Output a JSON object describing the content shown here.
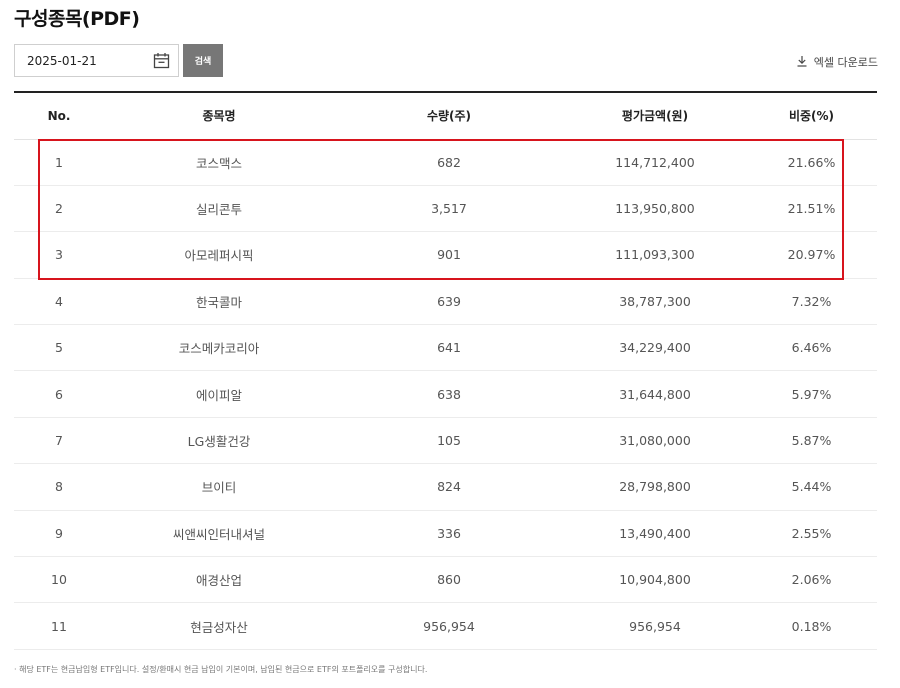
{
  "page": {
    "title": "구성종목(PDF)",
    "date_value": "2025-01-21",
    "search_label": "검색",
    "download_label": "엑셀 다운로드",
    "note": "· 해당 ETF는 현금납입형 ETF입니다. 설정/환매시 현금 납입이 기본이며, 납입된 현금으로 ETF의 포트폴리오를 구성합니다."
  },
  "table": {
    "headers": [
      "No.",
      "종목명",
      "수량(주)",
      "평가금액(원)",
      "비중(%)"
    ],
    "rows": [
      [
        "1",
        "코스맥스",
        "682",
        "114,712,400",
        "21.66%"
      ],
      [
        "2",
        "실리콘투",
        "3,517",
        "113,950,800",
        "21.51%"
      ],
      [
        "3",
        "아모레퍼시픽",
        "901",
        "111,093,300",
        "20.97%"
      ],
      [
        "4",
        "한국콜마",
        "639",
        "38,787,300",
        "7.32%"
      ],
      [
        "5",
        "코스메카코리아",
        "641",
        "34,229,400",
        "6.46%"
      ],
      [
        "6",
        "에이피알",
        "638",
        "31,644,800",
        "5.97%"
      ],
      [
        "7",
        "LG생활건강",
        "105",
        "31,080,000",
        "5.87%"
      ],
      [
        "8",
        "브이티",
        "824",
        "28,798,800",
        "5.44%"
      ],
      [
        "9",
        "씨앤씨인터내셔널",
        "336",
        "13,490,400",
        "2.55%"
      ],
      [
        "10",
        "애경산업",
        "860",
        "10,904,800",
        "2.06%"
      ],
      [
        "11",
        "현금성자산",
        "956,954",
        "956,954",
        "0.18%"
      ]
    ]
  },
  "colors": {
    "highlight": "#d7141d",
    "button_bg": "#777777"
  },
  "icons": {
    "date": "calendar-icon",
    "download": "download-icon"
  }
}
